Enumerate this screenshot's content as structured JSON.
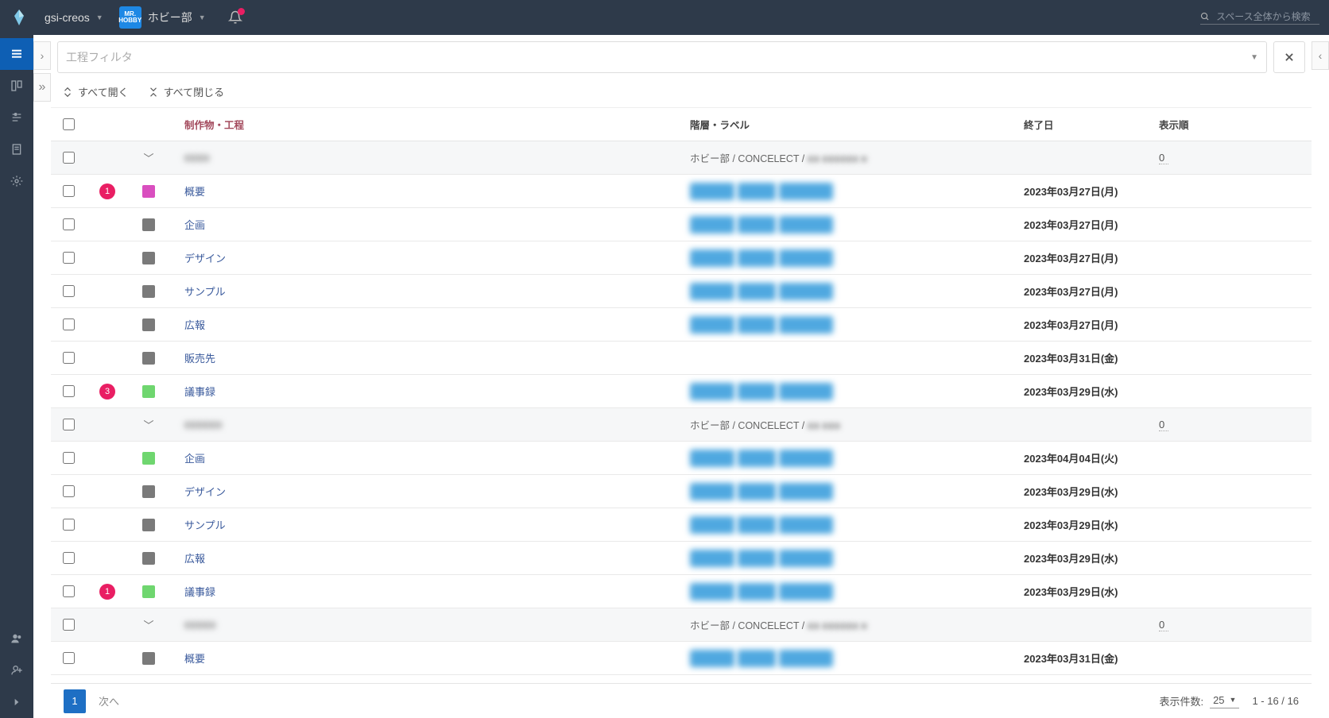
{
  "header": {
    "workspace": "gsi-creos",
    "space_badge_top": "MR.",
    "space_badge_bottom": "HOBBY",
    "space_name": "ホビー部",
    "search_placeholder": "スペース全体から検索"
  },
  "filter": {
    "placeholder": "工程フィルタ"
  },
  "toolbar": {
    "expand_all": "すべて開く",
    "collapse_all": "すべて閉じる"
  },
  "columns": {
    "name": "制作物・工程",
    "path": "階層・ラベル",
    "end_date": "終了日",
    "order": "表示順"
  },
  "path_prefix": "ホビー部 / CONCELECT / ",
  "rows": [
    {
      "type": "group",
      "name": "■■■■",
      "path_suffix": "■■ ■■■■■■ ■",
      "order": "0"
    },
    {
      "type": "item",
      "badge": "1",
      "color": "#d94fbf",
      "name": "概要",
      "tags": true,
      "date": "2023年03月27日(月)"
    },
    {
      "type": "item",
      "color": "#7a7a7a",
      "name": "企画",
      "tags": true,
      "date": "2023年03月27日(月)"
    },
    {
      "type": "item",
      "color": "#7a7a7a",
      "name": "デザイン",
      "tags": true,
      "date": "2023年03月27日(月)"
    },
    {
      "type": "item",
      "color": "#7a7a7a",
      "name": "サンプル",
      "tags": true,
      "date": "2023年03月27日(月)"
    },
    {
      "type": "item",
      "color": "#7a7a7a",
      "name": "広報",
      "tags": true,
      "date": "2023年03月27日(月)"
    },
    {
      "type": "item",
      "color": "#7a7a7a",
      "name": "販売先",
      "tags": false,
      "date": "2023年03月31日(金)"
    },
    {
      "type": "item",
      "badge": "3",
      "color": "#6fd66f",
      "name": "議事録",
      "tags": true,
      "date": "2023年03月29日(水)"
    },
    {
      "type": "group",
      "name": "■■■■■■",
      "path_suffix": "■■ ■■■",
      "order": "0"
    },
    {
      "type": "item",
      "color": "#6fd66f",
      "name": "企画",
      "tags": true,
      "date": "2023年04月04日(火)"
    },
    {
      "type": "item",
      "color": "#7a7a7a",
      "name": "デザイン",
      "tags": true,
      "date": "2023年03月29日(水)"
    },
    {
      "type": "item",
      "color": "#7a7a7a",
      "name": "サンプル",
      "tags": true,
      "date": "2023年03月29日(水)"
    },
    {
      "type": "item",
      "color": "#7a7a7a",
      "name": "広報",
      "tags": true,
      "date": "2023年03月29日(水)"
    },
    {
      "type": "item",
      "badge": "1",
      "color": "#6fd66f",
      "name": "議事録",
      "tags": true,
      "date": "2023年03月29日(水)"
    },
    {
      "type": "group",
      "name": "■■■■■",
      "path_suffix": "■■ ■■■■■■ ■",
      "order": "0"
    },
    {
      "type": "item",
      "color": "#7a7a7a",
      "name": "概要",
      "tags": true,
      "date": "2023年03月31日(金)"
    }
  ],
  "footer": {
    "current_page": "1",
    "next": "次へ",
    "perpage_label": "表示件数:",
    "perpage_value": "25",
    "range": "1 - 16 / 16"
  }
}
